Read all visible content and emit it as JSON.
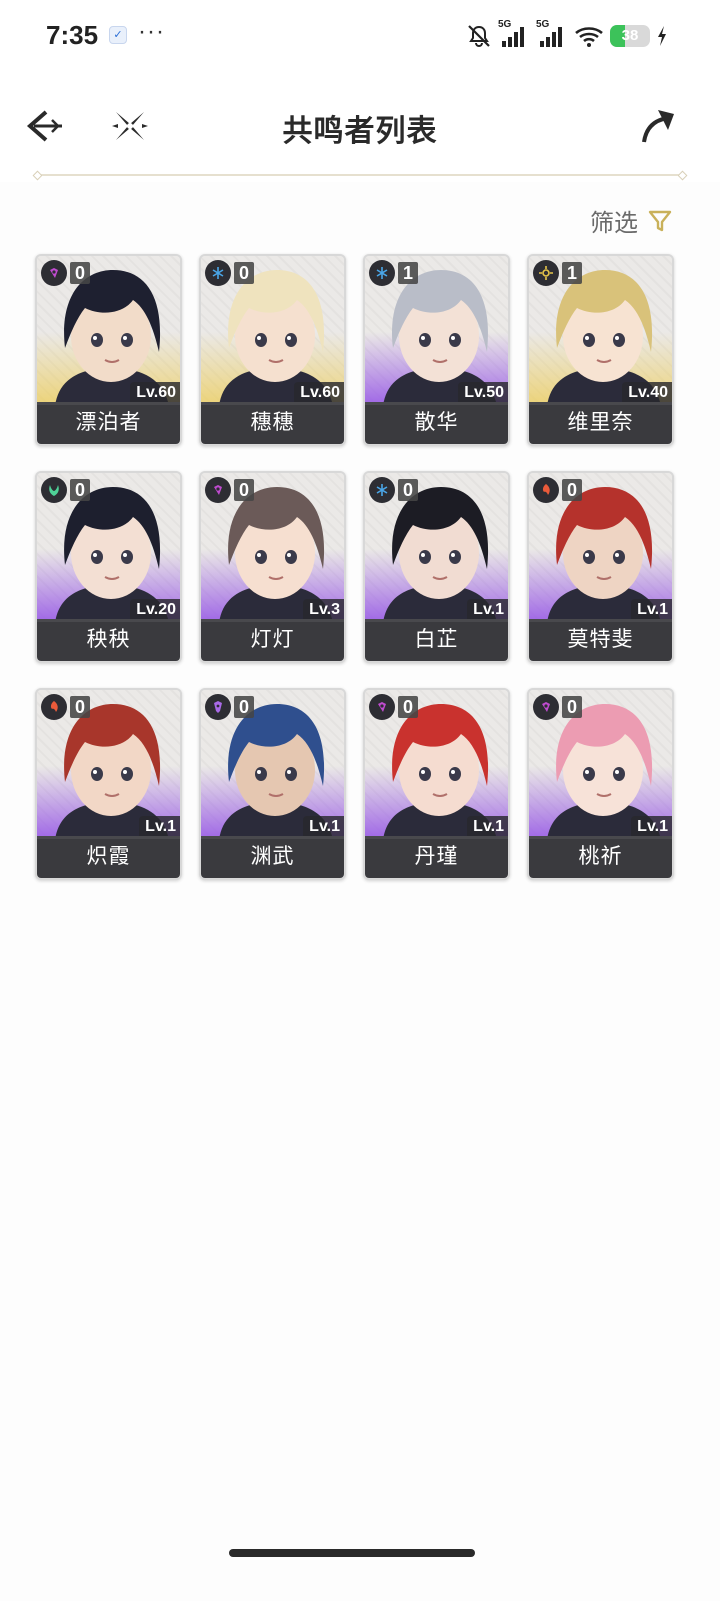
{
  "status_bar": {
    "time": "7:35",
    "more": "···",
    "network_1": "5G",
    "network_2": "5G",
    "battery": "38",
    "battery_level": 0.38
  },
  "header": {
    "title": "共鸣者列表",
    "back_icon": "back-arrow-icon",
    "crossed_icon": "crossed-blades-icon",
    "share_icon": "share-arrow-icon"
  },
  "filter": {
    "label": "筛选",
    "icon": "funnel-icon",
    "accent": "#c9b15a"
  },
  "characters": [
    {
      "name": "漂泊者",
      "level": "Lv.60",
      "chain": "0",
      "element": "havoc",
      "rarity": "gold",
      "hair": "#1e2030",
      "skin": "#f2dcc9"
    },
    {
      "name": "穗穗",
      "level": "Lv.60",
      "chain": "0",
      "element": "glacio",
      "rarity": "gold",
      "hair": "#efe3be",
      "skin": "#f5e0cf"
    },
    {
      "name": "散华",
      "level": "Lv.50",
      "chain": "1",
      "element": "glacio",
      "rarity": "purple",
      "hair": "#b9bdc8",
      "skin": "#f3e1d6"
    },
    {
      "name": "维里奈",
      "level": "Lv.40",
      "chain": "1",
      "element": "spectro",
      "rarity": "gold",
      "hair": "#d9c27a",
      "skin": "#f7e3d2"
    },
    {
      "name": "秧秧",
      "level": "Lv.20",
      "chain": "0",
      "element": "aero",
      "rarity": "purple",
      "hair": "#1d1f2e",
      "skin": "#f3dfd3"
    },
    {
      "name": "灯灯",
      "level": "Lv.3",
      "chain": "0",
      "element": "havoc",
      "rarity": "purple",
      "hair": "#6b5a58",
      "skin": "#f6dfd0"
    },
    {
      "name": "白芷",
      "level": "Lv.1",
      "chain": "0",
      "element": "glacio",
      "rarity": "purple",
      "hair": "#1c1c24",
      "skin": "#f1dcd2"
    },
    {
      "name": "莫特斐",
      "level": "Lv.1",
      "chain": "0",
      "element": "fusion",
      "rarity": "purple",
      "hair": "#b5322c",
      "skin": "#eed4c3"
    },
    {
      "name": "炽霞",
      "level": "Lv.1",
      "chain": "0",
      "element": "fusion",
      "rarity": "purple",
      "hair": "#a8362b",
      "skin": "#f2d7c6"
    },
    {
      "name": "渊武",
      "level": "Lv.1",
      "chain": "0",
      "element": "electro",
      "rarity": "purple",
      "hair": "#2f4f8e",
      "skin": "#e5c7b1"
    },
    {
      "name": "丹瑾",
      "level": "Lv.1",
      "chain": "0",
      "element": "havoc",
      "rarity": "purple",
      "hair": "#c9322e",
      "skin": "#f5dcd0"
    },
    {
      "name": "桃祈",
      "level": "Lv.1",
      "chain": "0",
      "element": "havoc",
      "rarity": "purple",
      "hair": "#ec9cb2",
      "skin": "#f7e2d8"
    }
  ],
  "element_colors": {
    "havoc": "#c04bd0",
    "glacio": "#4aa6e8",
    "spectro": "#e6c54a",
    "aero": "#4fd197",
    "fusion": "#ea5a3a",
    "electro": "#a96ae8"
  }
}
